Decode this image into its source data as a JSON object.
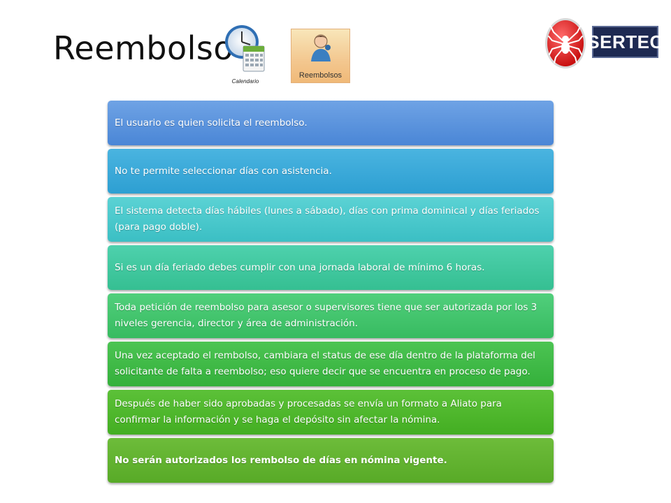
{
  "title": "Reembolso",
  "icons": {
    "calendar": {
      "name": "calendar-clock-icon",
      "label": "Calendario"
    },
    "reembolsos": {
      "name": "person-icon",
      "label": "Reembolsos"
    }
  },
  "logo": {
    "brand": "SERTEC",
    "mark": "spider-logo"
  },
  "colors": {
    "box1": "#5a94de",
    "box2": "#39a9d9",
    "box3": "#4ac8cb",
    "box4": "#41c8a0",
    "box5": "#44c56e",
    "box6": "#40ba47",
    "box7": "#4fb72d",
    "box8": "#62b330",
    "logo_red": "#e02020",
    "logo_navy": "#1e2a52"
  },
  "items": [
    "El usuario es quien solicita el reembolso.",
    "No te permite seleccionar días con asistencia.",
    "El sistema detecta días hábiles (lunes a sábado), días con prima dominical y días feriados (para pago doble).",
    "Si es un día feriado debes cumplir con una jornada laboral de mínimo 6 horas.",
    "Toda petición de reembolso para asesor o supervisores tiene que ser autorizada por los 3 niveles gerencia, director y área de administración.",
    "Una vez aceptado el rembolso, cambiara el status de ese día dentro de la plataforma del solicitante de falta a reembolso; eso quiere decir que se encuentra en proceso de pago.",
    "Después de haber sido aprobadas y procesadas se envía un formato a Aliato para confirmar la información y se haga el depósito sin afectar la nómina.",
    "No serán autorizados los rembolso de días en nómina vigente."
  ]
}
